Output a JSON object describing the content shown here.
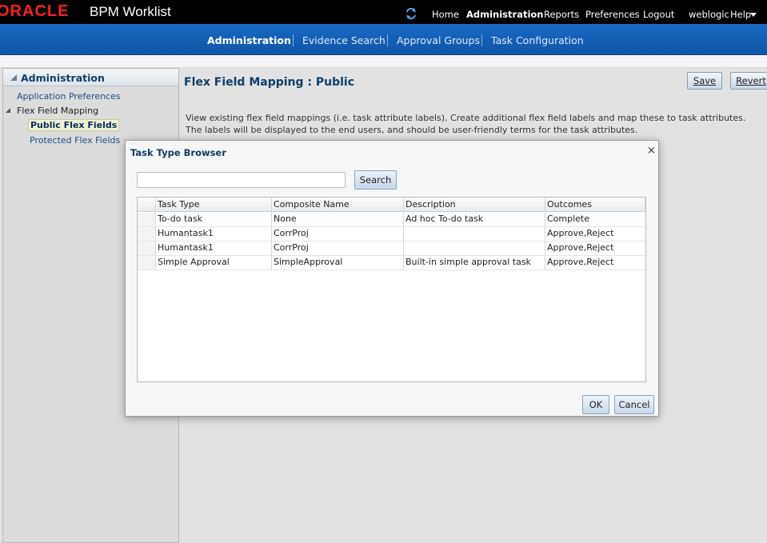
{
  "header": {
    "logo_text": "ORACLE",
    "app_title": "BPM Worklist",
    "nav": {
      "home": "Home",
      "administration": "Administration",
      "reports": "Reports",
      "preferences": "Preferences",
      "logout": "Logout",
      "user": "weblogic",
      "help": "Help"
    }
  },
  "tabs": {
    "administration": "Administration",
    "evidence_search": "Evidence Search",
    "approval_groups": "Approval Groups",
    "task_configuration": "Task Configuration"
  },
  "left_panel": {
    "title": "Administration",
    "items": {
      "application_preferences": "Application Preferences",
      "flex_field_mapping": "Flex Field Mapping",
      "public_flex_fields": "Public Flex Fields",
      "protected_flex_fields": "Protected Flex Fields"
    }
  },
  "main": {
    "title": "Flex Field Mapping : Public",
    "save_label": "Save",
    "revert_label": "Revert",
    "description_line1": "View existing flex field mappings (i.e. task attribute labels). Create additional flex field labels and map these to task attributes.",
    "description_line2": "The labels will be displayed to the end users, and should be user-friendly terms for the task attributes."
  },
  "dialog": {
    "title": "Task Type Browser",
    "close_glyph": "×",
    "search_value": "",
    "search_button": "Search",
    "columns": {
      "task_type": "Task Type",
      "composite_name": "Composite Name",
      "description": "Description",
      "outcomes": "Outcomes"
    },
    "rows": [
      {
        "task_type": "To-do task",
        "composite_name": "None",
        "description": "Ad hoc To-do task",
        "outcomes": "Complete"
      },
      {
        "task_type": "Humantask1",
        "composite_name": "CorrProj",
        "description": "",
        "outcomes": "Approve,Reject"
      },
      {
        "task_type": "Humantask1",
        "composite_name": "CorrProj",
        "description": "",
        "outcomes": "Approve,Reject"
      },
      {
        "task_type": "Simple Approval",
        "composite_name": "SimpleApproval",
        "description": "Built-in simple approval task",
        "outcomes": "Approve,Reject"
      }
    ],
    "ok_label": "OK",
    "cancel_label": "Cancel"
  },
  "colors": {
    "brand_red": "#ff1f1f",
    "tabbar_blue": "#1a6ac4",
    "title_navy": "#103d68"
  }
}
